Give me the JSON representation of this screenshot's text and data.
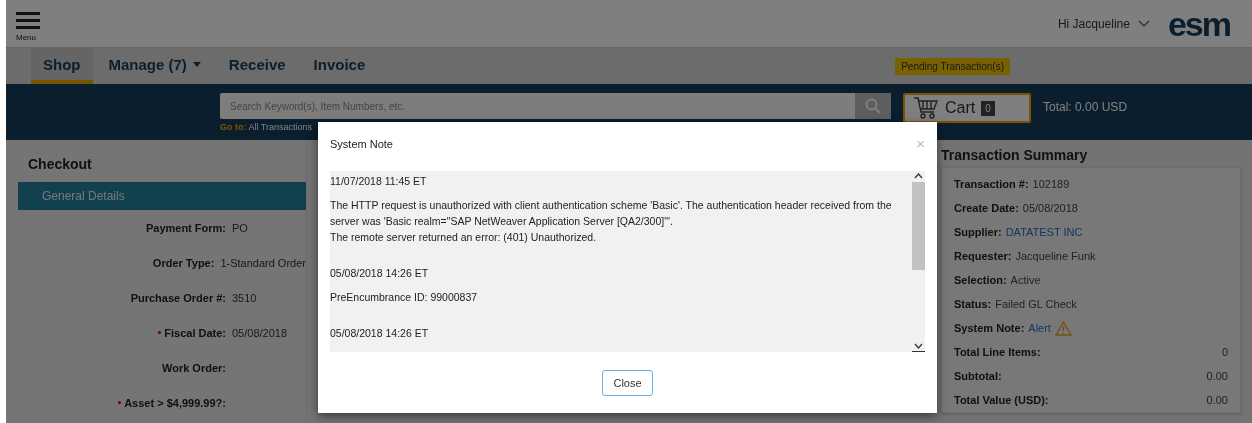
{
  "header": {
    "menu_label": "Menu",
    "greeting": "Hi Jacqueline",
    "logo": "esm"
  },
  "nav": {
    "tabs": [
      {
        "label": "Shop",
        "selected": true,
        "dropdown": false
      },
      {
        "label": "Manage (7)",
        "selected": false,
        "dropdown": true
      },
      {
        "label": "Receive",
        "selected": false,
        "dropdown": false
      },
      {
        "label": "Invoice",
        "selected": false,
        "dropdown": false
      }
    ],
    "pending_badge": "Pending Transaction(s)"
  },
  "search": {
    "placeholder": "Search Keyword(s), Item Numbers, etc.",
    "goto_label": "Go to:",
    "goto_link": "All Transactions"
  },
  "cart": {
    "label": "Cart",
    "count": "0",
    "total": "Total: 0.00 USD"
  },
  "checkout": {
    "title": "Checkout",
    "section": "General Details",
    "fields": [
      {
        "label": "Payment Form:",
        "value": "PO",
        "required": false
      },
      {
        "label": "Order Type:",
        "value": "1-Standard Order",
        "required": false
      },
      {
        "label": "Purchase Order #:",
        "value": "3510",
        "required": false
      },
      {
        "label": "Fiscal Date:",
        "value": "05/08/2018",
        "required": true
      },
      {
        "label": "Work Order:",
        "required": false
      },
      {
        "label": "Asset > $4,999.99?:",
        "required": true
      }
    ]
  },
  "summary": {
    "title": "Transaction Summary",
    "rows": [
      {
        "label": "Transaction #:",
        "value": "102189",
        "kind": "text"
      },
      {
        "label": "Create Date:",
        "value": "05/08/2018",
        "kind": "text"
      },
      {
        "label": "Supplier:",
        "value": "DATATEST INC",
        "kind": "link"
      },
      {
        "label": "Requester:",
        "value": "Jacqueline Funk",
        "kind": "text"
      },
      {
        "label": "Selection:",
        "value": "Active",
        "kind": "text"
      },
      {
        "label": "Status:",
        "value": "Failed GL Check",
        "kind": "text"
      },
      {
        "label": "System Note:",
        "value": "Alert",
        "kind": "alert"
      },
      {
        "label": "Total Line Items:",
        "value": "0",
        "kind": "amount"
      },
      {
        "label": "Subtotal:",
        "value": "0.00",
        "kind": "amount"
      },
      {
        "label": "Total Value (USD):",
        "value": "0.00",
        "kind": "amount"
      }
    ]
  },
  "modal": {
    "title": "System Note",
    "close_glyph": "×",
    "entries": [
      {
        "timestamp": "11/07/2018 11:45 ET",
        "lines": [
          "The HTTP request is unauthorized with client authentication scheme 'Basic'. The authentication header received from the server was 'Basic realm=\"SAP NetWeaver Application Server [QA2/300]\"'.",
          "The remote server returned an error: (401) Unauthorized."
        ]
      },
      {
        "timestamp": "05/08/2018 14:26 ET",
        "lines": [
          "PreEncumbrance ID: 99000837"
        ]
      },
      {
        "timestamp": "05/08/2018 14:26 ET"
      }
    ],
    "button": "Close"
  }
}
